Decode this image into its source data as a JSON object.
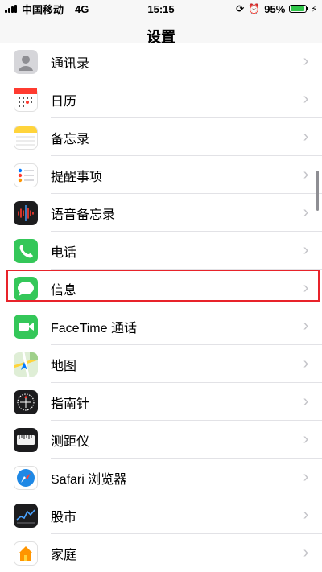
{
  "status_bar": {
    "carrier": "中国移动",
    "network": "4G",
    "time": "15:15",
    "battery": "95%",
    "battery_level": 0.95
  },
  "nav": {
    "title": "设置"
  },
  "items": [
    {
      "label": "通讯录",
      "icon": "contacts-icon",
      "color": "#d6d6da"
    },
    {
      "label": "日历",
      "icon": "calendar-icon",
      "color": "#ffffff"
    },
    {
      "label": "备忘录",
      "icon": "notes-icon",
      "color": "#ffffff"
    },
    {
      "label": "提醒事项",
      "icon": "reminders-icon",
      "color": "#ffffff"
    },
    {
      "label": "语音备忘录",
      "icon": "voice-memos-icon",
      "color": "#1c1c1e"
    },
    {
      "label": "电话",
      "icon": "phone-icon",
      "color": "#34c759"
    },
    {
      "label": "信息",
      "icon": "messages-icon",
      "color": "#34c759"
    },
    {
      "label": "FaceTime 通话",
      "icon": "facetime-icon",
      "color": "#34c759"
    },
    {
      "label": "地图",
      "icon": "maps-icon",
      "color": "#e8efe4"
    },
    {
      "label": "指南针",
      "icon": "compass-icon",
      "color": "#1c1c1e"
    },
    {
      "label": "测距仪",
      "icon": "measure-icon",
      "color": "#1c1c1e"
    },
    {
      "label": "Safari 浏览器",
      "icon": "safari-icon",
      "color": "#ffffff"
    },
    {
      "label": "股市",
      "icon": "stocks-icon",
      "color": "#1c1c1e"
    },
    {
      "label": "家庭",
      "icon": "home-icon",
      "color": "#ffffff"
    }
  ],
  "chevron": "›"
}
